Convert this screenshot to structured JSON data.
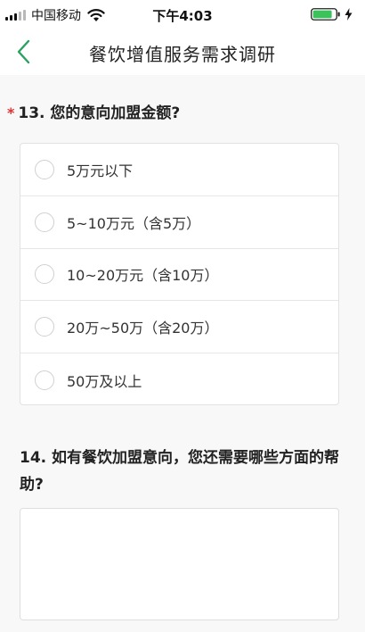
{
  "status_bar": {
    "carrier": "中国移动",
    "time": "下午4:03",
    "battery_color": "#3cc25a"
  },
  "nav": {
    "title": "餐饮增值服务需求调研",
    "back_icon": "chevron-left-icon",
    "accent": "#2aa160"
  },
  "questions": [
    {
      "required_mark": "*",
      "title": "13. 您的意向加盟金额?",
      "type": "radio",
      "options": [
        "5万元以下",
        "5~10万元（含5万）",
        "10~20万元（含10万）",
        "20万~50万（含20万）",
        "50万及以上"
      ]
    },
    {
      "title": "14. 如有餐饮加盟意向，您还需要哪些方面的帮助?",
      "type": "textarea",
      "value": ""
    }
  ]
}
